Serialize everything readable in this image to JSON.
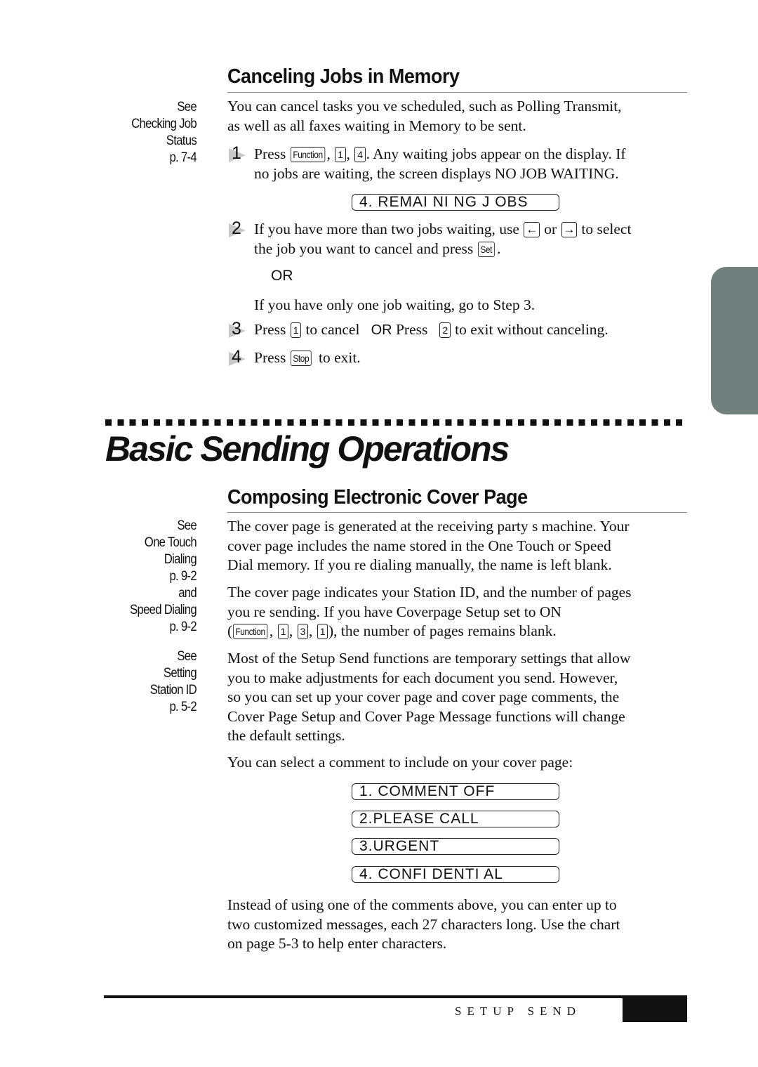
{
  "colors": {
    "side_tab": "#6f807d",
    "text": "#111111",
    "step_marker": "#c8c8c8"
  },
  "section1": {
    "heading": "Canceling Jobs in Memory",
    "sidenote": [
      "See",
      "Checking Job",
      "Status",
      "p. 7-4"
    ],
    "intro": [
      "You can cancel tasks you ve scheduled, such as Polling Transmit,",
      "as well as all faxes waiting in Memory to be sent."
    ],
    "step1": {
      "number": "1",
      "pre": "Press ",
      "key_function": "Function",
      "sep1": ", ",
      "key_1": "1",
      "sep2": ", ",
      "key_4": "4",
      "post": ". Any waiting jobs appear on the display. If",
      "line2": "no jobs are waiting, the screen displays NO JOB WAITING."
    },
    "lcd": "4. REMAI NI NG J OBS",
    "step2": {
      "number": "2",
      "pre": "If you have more than two jobs waiting, use ",
      "key_left": "←",
      "mid": " or ",
      "key_right": "→",
      "post": " to select",
      "line2_pre": "the job you want to cancel and press ",
      "key_set": "Set",
      "line2_post": "."
    },
    "or_label": "OR",
    "single_job": "If you have only one job waiting, go to Step 3.",
    "step3": {
      "number": "3",
      "pre": "Press ",
      "key_1": "1",
      "mid": " to cancel   ",
      "or": "OR",
      "mid2": " Press   ",
      "key_2": "2",
      "post": " to exit without canceling."
    },
    "step4": {
      "number": "4",
      "pre": "Press ",
      "key_stop": "Stop",
      "post": " to exit."
    }
  },
  "chapter_title": "Basic Sending Operations",
  "section2": {
    "heading": "Composing Electronic Cover Page",
    "sidenote1": [
      "See",
      "One Touch",
      "Dialing",
      "p. 9-2",
      "and",
      "Speed Dialing",
      "p. 9-2"
    ],
    "sidenote2": [
      "See",
      "Setting",
      "Station ID",
      "p. 5-2"
    ],
    "para1": [
      "The cover page is generated at the receiving party s machine. Your",
      "cover page includes the name stored in the One Touch or Speed",
      "Dial memory. If you re dialing manually, the name is left blank."
    ],
    "para2": [
      "The cover page indicates your Station ID, and the number of pages",
      "you re sending. If you have Coverpage Setup set to ON"
    ],
    "para2_line3": {
      "open": "(",
      "key_function": "Function",
      "sep1": ", ",
      "key_a": "1",
      "sep2": ", ",
      "key_b": "3",
      "sep3": ", ",
      "key_c": "1",
      "post": "), the number of pages remains blank."
    },
    "para3": [
      "Most of the Setup Send functions are temporary settings that allow",
      "you to make adjustments for each document you send. However,",
      "so you can set up your cover page and cover page comments, the",
      "Cover Page Setup and Cover Page Message functions will change",
      "the default settings."
    ],
    "para4": "You can select a comment to include on your cover page:",
    "lcd_options": [
      "1. COMMENT  OFF",
      "2.PLEASE CALL",
      "3.URGENT",
      "4. CONFI DENTI AL"
    ],
    "para5": [
      "Instead of using one of the comments above, you can enter up to",
      "two customized messages, each 27 characters long. Use the chart",
      "on page 5-3 to help enter characters."
    ]
  },
  "footer": {
    "section_label": "SETUP SEND"
  }
}
